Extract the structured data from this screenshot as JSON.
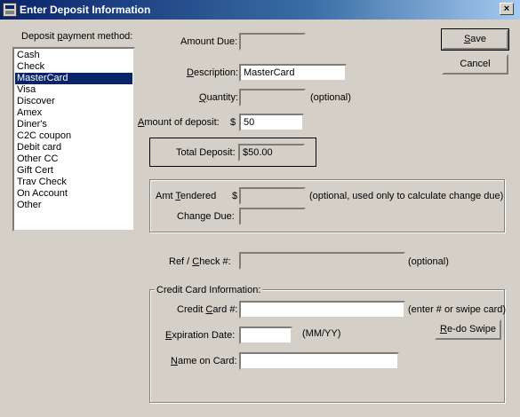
{
  "window": {
    "title": "Enter Deposit Information",
    "close_symbol": "×"
  },
  "payment_method": {
    "label": "Deposit payment method:",
    "items": [
      "Cash",
      "Check",
      "MasterCard",
      "Visa",
      "Discover",
      "Amex",
      "Diner's",
      "C2C coupon",
      "Debit card",
      "Other CC",
      "Gift Cert",
      "Trav Check",
      "On Account",
      "Other"
    ],
    "selected": "MasterCard"
  },
  "amount_due": {
    "label": "Amount Due:",
    "value": ""
  },
  "description": {
    "label": "Description:",
    "value": "MasterCard"
  },
  "quantity": {
    "label": "Quantity:",
    "value": "",
    "note": "(optional)"
  },
  "amount_of_deposit": {
    "label": "Amount of deposit:",
    "currency": "$",
    "value": "50"
  },
  "total_deposit": {
    "label": "Total Deposit:",
    "value": "$50.00"
  },
  "amt_tendered": {
    "label": "Amt Tendered",
    "currency": "$",
    "value": "",
    "note": "(optional, used only to calculate change due)"
  },
  "change_due": {
    "label": "Change Due:",
    "value": ""
  },
  "ref_check": {
    "label": "Ref / Check #:",
    "value": "",
    "note": "(optional)"
  },
  "credit_card": {
    "legend": "Credit Card Information:",
    "card_label": "Credit Card #:",
    "card_value": "",
    "card_note": "(enter # or swipe card)",
    "exp_label": "Expiration Date:",
    "exp_value": "",
    "exp_note": "(MM/YY)",
    "name_label": "Name on Card:",
    "name_value": "",
    "redo_swipe_label": "Re-do Swipe"
  },
  "buttons": {
    "save": "Save",
    "cancel": "Cancel"
  }
}
